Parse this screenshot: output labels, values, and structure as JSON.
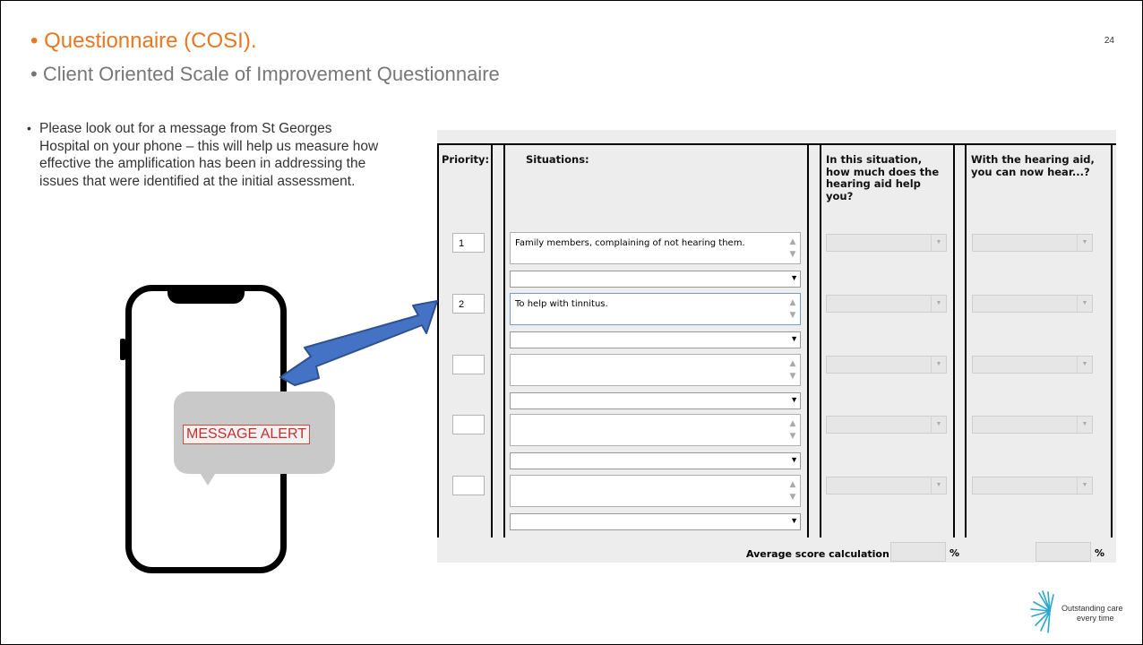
{
  "slide": {
    "title": "Questionnaire (COSI).",
    "subtitle": "Client Oriented Scale of Improvement Questionnaire",
    "page_number": "24",
    "note": "Please look out for a message from St Georges Hospital on your phone – this will help us measure how effective the amplification has been in addressing the issues that were identified at the initial assessment."
  },
  "phone": {
    "alert_text": "MESSAGE ALERT"
  },
  "form": {
    "headers": {
      "priority": "Priority:",
      "situations": "Situations:",
      "help": "In this situation, how much does the hearing aid help you?",
      "hear": "With the hearing aid, you can now hear...?"
    },
    "rows": [
      {
        "priority": "1",
        "situation": "Family members, complaining of not hearing them."
      },
      {
        "priority": "2",
        "situation": "To help with tinnitus."
      },
      {
        "priority": "",
        "situation": ""
      },
      {
        "priority": "",
        "situation": ""
      },
      {
        "priority": "",
        "situation": ""
      }
    ],
    "average_label": "Average score calculation",
    "percent_sign": "%"
  },
  "logo": {
    "line1": "Outstanding care",
    "line2": "every time"
  },
  "colors": {
    "title": "#e87722",
    "arrow": "#4472c4",
    "alert": "#c62f2f"
  }
}
